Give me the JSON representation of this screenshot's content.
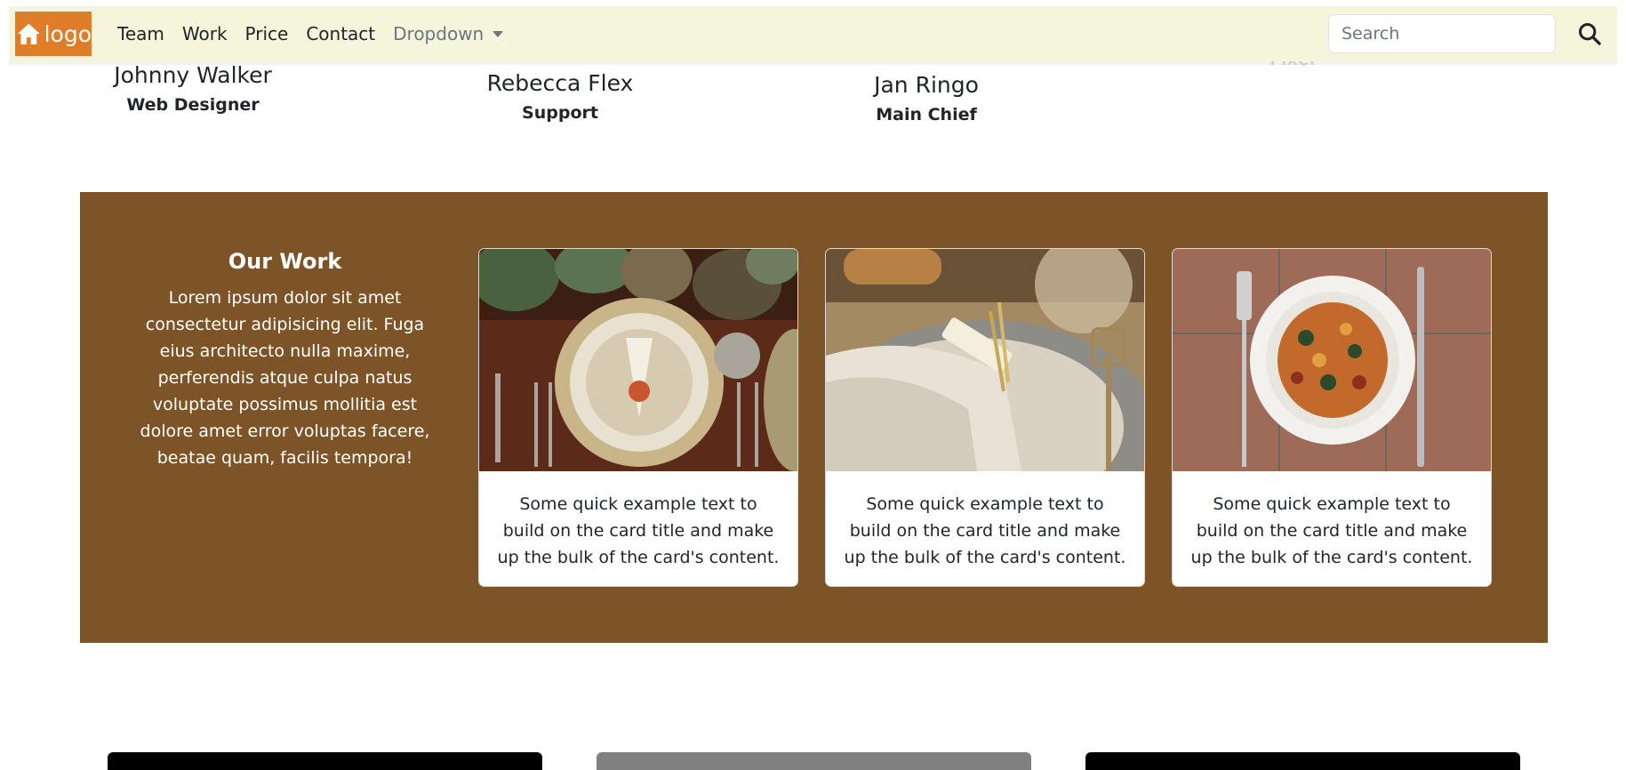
{
  "team": [
    {
      "name": "Johnny Walker",
      "role": "Web Designer"
    },
    {
      "name": "Rebecca Flex",
      "role": "Support"
    },
    {
      "name": "Jan Ringo",
      "role": "Main Chief"
    },
    {
      "name": "",
      "role": "Fixer"
    }
  ],
  "navbar": {
    "brand": "logo",
    "brand_icon": "home-icon",
    "links": [
      "Team",
      "Work",
      "Price",
      "Contact"
    ],
    "dropdown_label": "Dropdown",
    "search_placeholder": "Search",
    "search_icon": "search-icon",
    "background": "#f5f5dc",
    "brand_color": "#e07d28"
  },
  "work": {
    "title": "Our Work",
    "text": "Lorem ipsum dolor sit amet consectetur adipisicing elit. Fuga eius architecto nulla maxime, perferendis atque culpa natus voluptate possimus mollitia est dolore amet error voluptas facere, beatae quam, facilis tempora!",
    "background": "#7d5427",
    "cards": [
      {
        "text": "Some quick example text to build on the card title and make up the bulk of the card's content."
      },
      {
        "text": "Some quick example text to build on the card title and make up the bulk of the card's content."
      },
      {
        "text": "Some quick example text to build on the card title and make up the bulk of the card's content."
      }
    ]
  }
}
